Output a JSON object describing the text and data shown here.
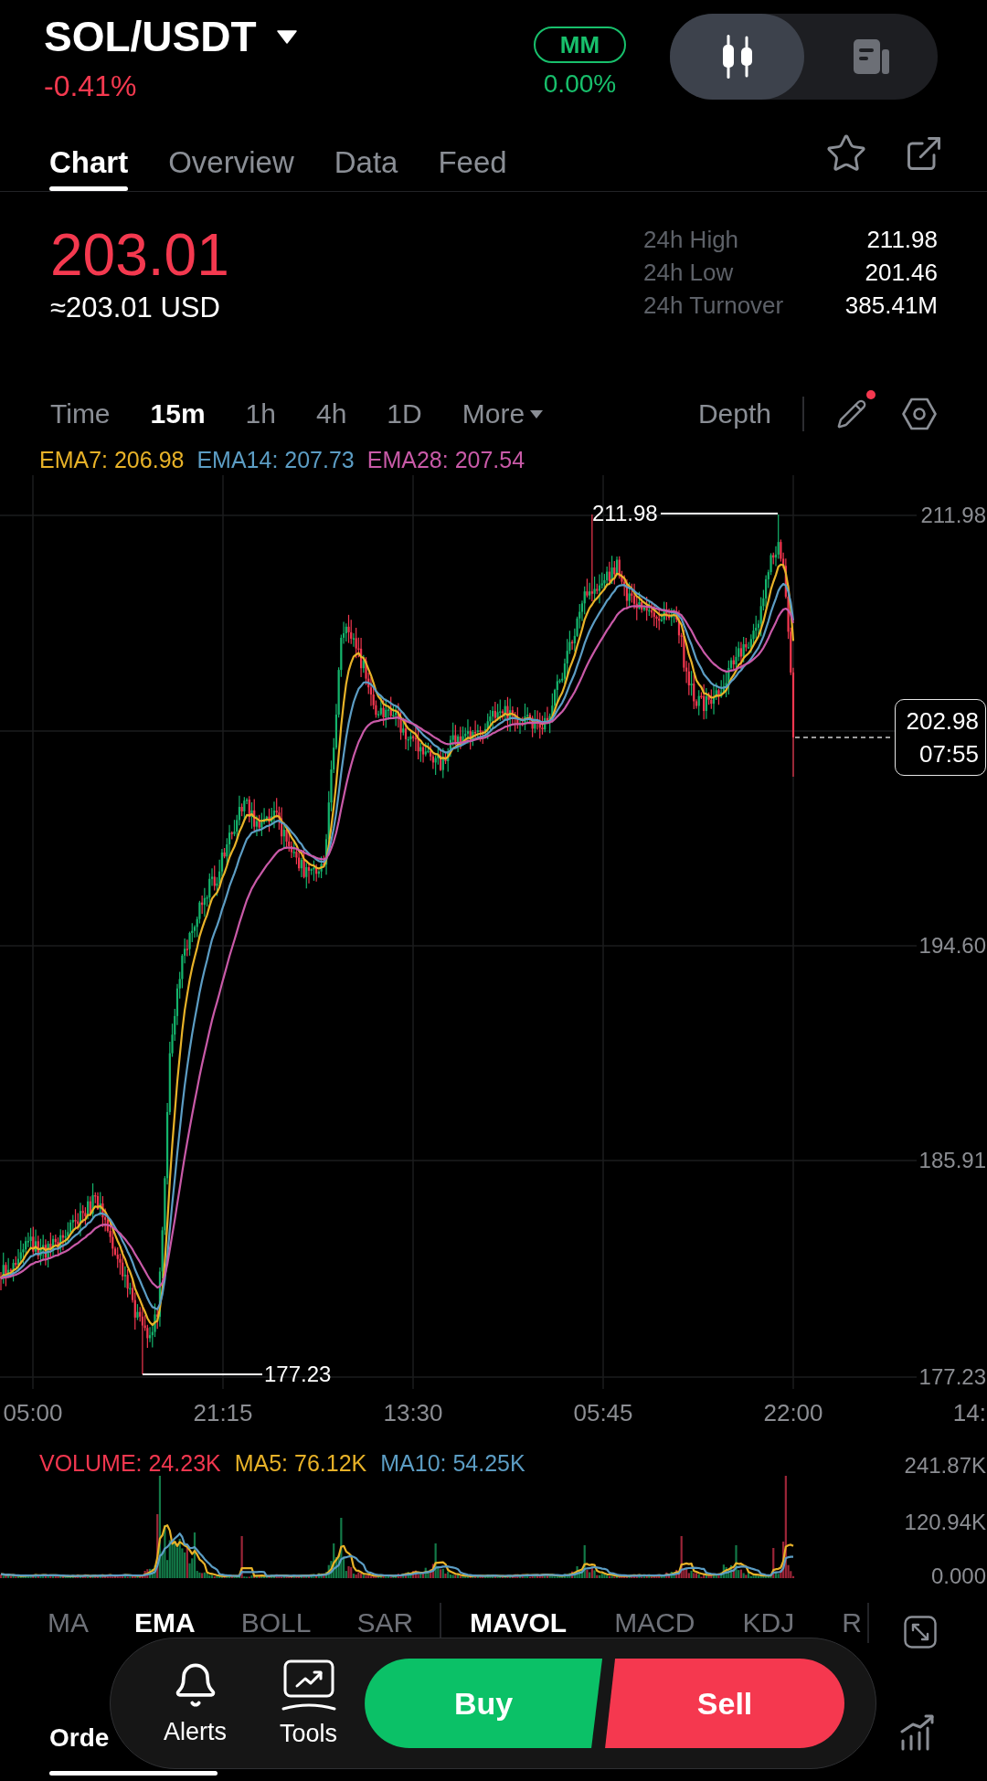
{
  "header": {
    "pair": "SOL/USDT",
    "change": "-0.41%",
    "tag": {
      "label": "MM",
      "value": "0.00%"
    },
    "view_toggle": [
      {
        "kind": "candles",
        "selected": true
      },
      {
        "kind": "document",
        "selected": false
      }
    ]
  },
  "tabs": [
    {
      "label": "Chart",
      "selected": true
    },
    {
      "label": "Overview",
      "selected": false
    },
    {
      "label": "Data",
      "selected": false
    },
    {
      "label": "Feed",
      "selected": false
    }
  ],
  "quote": {
    "price": "203.01",
    "usd": "≈203.01 USD",
    "stats": [
      {
        "label": "24h High",
        "value": "211.98"
      },
      {
        "label": "24h Low",
        "value": "201.46"
      },
      {
        "label": "24h Turnover",
        "value": "385.41M"
      }
    ]
  },
  "intervals": [
    {
      "label": "Time",
      "selected": false,
      "dropdown": false
    },
    {
      "label": "15m",
      "selected": true,
      "dropdown": false
    },
    {
      "label": "1h",
      "selected": false,
      "dropdown": false
    },
    {
      "label": "4h",
      "selected": false,
      "dropdown": false
    },
    {
      "label": "1D",
      "selected": false,
      "dropdown": false
    },
    {
      "label": "More",
      "selected": false,
      "dropdown": true
    }
  ],
  "depth": "Depth",
  "draw_tool": {
    "notification": true
  },
  "ema_legend": [
    {
      "label": "EMA7: 206.98",
      "color": "#e8b228"
    },
    {
      "label": "EMA14: 207.73",
      "color": "#5c9dc4"
    },
    {
      "label": "EMA28: 207.54",
      "color": "#c95aa8"
    }
  ],
  "chart": {
    "price_ticks": [
      "211.98",
      "194.60",
      "185.91",
      "177.23"
    ],
    "high_label": "211.98",
    "low_label": "177.23",
    "last_price": "202.98",
    "countdown": "07:55",
    "time_ticks": [
      "05:00",
      "21:15",
      "13:30",
      "05:45",
      "22:00",
      "14:"
    ]
  },
  "volume": {
    "legend": [
      {
        "label": "VOLUME: 24.23K",
        "color": "#f2374f"
      },
      {
        "label": "MA5: 76.12K",
        "color": "#e8b228"
      },
      {
        "label": "MA10: 54.25K",
        "color": "#5c9dc4"
      }
    ],
    "ticks": [
      "241.87K",
      "120.94K",
      "0.000"
    ]
  },
  "indicators": {
    "main": [
      {
        "label": "MA",
        "selected": false
      },
      {
        "label": "EMA",
        "selected": true
      },
      {
        "label": "BOLL",
        "selected": false
      },
      {
        "label": "SAR",
        "selected": false
      }
    ],
    "sub": [
      {
        "label": "MAVOL",
        "selected": true
      },
      {
        "label": "MACD",
        "selected": false
      },
      {
        "label": "KDJ",
        "selected": false
      },
      {
        "label": "R",
        "selected": false
      }
    ]
  },
  "panel_tab": {
    "label": "Orde",
    "selected": true
  },
  "action_bar": {
    "tools": [
      {
        "kind": "alerts",
        "label": "Alerts"
      },
      {
        "kind": "tools",
        "label": "Tools"
      }
    ],
    "buy": "Buy",
    "sell": "Sell"
  }
}
